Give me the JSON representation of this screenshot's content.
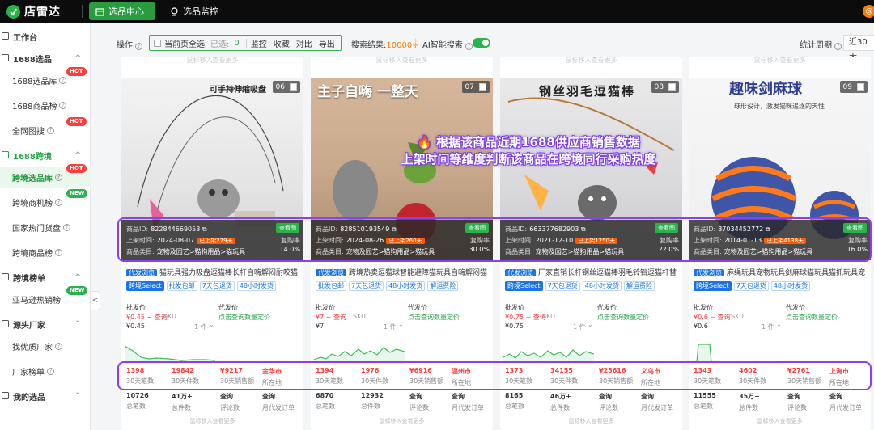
{
  "app": {
    "name": "店雷达",
    "tabs": [
      {
        "label": "选品中心",
        "active": true
      },
      {
        "label": "选品监控",
        "active": false
      }
    ],
    "user_initial": "赠"
  },
  "sidebar": {
    "items": [
      {
        "type": "group",
        "label": "工作台"
      },
      {
        "type": "group",
        "label": "1688选品",
        "arrow": "^"
      },
      {
        "type": "sub",
        "label": "1688选品库",
        "badge": "HOT",
        "q": true
      },
      {
        "type": "sub",
        "label": "1688商品榜",
        "q": true
      },
      {
        "type": "sub",
        "label": "全网图搜",
        "badge": "HOT",
        "q": true
      },
      {
        "type": "group",
        "label": "1688跨境",
        "arrow": "^",
        "green": true
      },
      {
        "type": "sub",
        "label": "跨境选品库",
        "badge": "HOT",
        "q": true,
        "active": true
      },
      {
        "type": "sub",
        "label": "跨境商机榜",
        "badge": "NEW",
        "q": true
      },
      {
        "type": "sub",
        "label": "国家热门货盘",
        "q": true
      },
      {
        "type": "sub",
        "label": "跨境商品榜",
        "q": true
      },
      {
        "type": "group",
        "label": "跨境榜单",
        "arrow": "^"
      },
      {
        "type": "sub",
        "label": "亚马逊热销榜",
        "badge": "NEW"
      },
      {
        "type": "group",
        "label": "源头厂家",
        "arrow": "^"
      },
      {
        "type": "sub",
        "label": "找优质厂家",
        "q": true
      },
      {
        "type": "sub",
        "label": "厂家榜单",
        "q": true
      },
      {
        "type": "group",
        "label": "我的选品",
        "arrow": "^"
      }
    ],
    "collapse": "<"
  },
  "toolbar": {
    "op_label": "操作",
    "select_page": "当前页全选",
    "selected_label": "已选:",
    "selected_count": "0",
    "actions": [
      "监控",
      "收藏",
      "对比",
      "导出"
    ],
    "search_result_label": "搜索结果:",
    "search_result_value": "10000+",
    "ai_search_label": "AI智能搜索",
    "period_label": "统计周期",
    "period_value": "近30天"
  },
  "faded_top": "鼠标移入查看更多",
  "annotation": {
    "line1": "根据该商品近期1688供应商销售数据",
    "line2": "上架时间等维度判断该商品在跨境同行采购热度"
  },
  "labels": {
    "product_id": "商品ID:",
    "listed": "上架时间:",
    "category": "商品类目:",
    "view": "查看图",
    "repurchase": "复购率",
    "batch_price": "批发价",
    "dropship_price": "代发价",
    "click_query": "点击查询数量定价",
    "sku": "SKU",
    "unit": "1 件",
    "s_30_orders": "30天笔数",
    "s_30_items": "30天件数",
    "s_30_sales": "30天销售额",
    "s_location": "所在地",
    "t_orders": "总笔数",
    "t_items": "总件数",
    "t_reviews": "评论数",
    "t_monthly": "月代发订单",
    "query": "查询",
    "hover_more": "鼠标移入查看更多"
  },
  "cards": [
    {
      "num": "06",
      "caption": "可手持伸缩吸盘",
      "sub": "",
      "id": "822844669053",
      "date": "2024-08-07",
      "on_days": "已上架279天",
      "category": "宠物及园艺>猫狗用品>猫玩具",
      "repurchase": "14.0%",
      "title_tag": "代发浏览",
      "title": "猫玩具强力吸盘逗猫棒长杆自嗨解闷耐咬猫...",
      "services": [
        "跨境Select",
        "批发包邮",
        "7天包退货",
        "48小时发货"
      ],
      "batch": "¥0.45 ~ 查询",
      "batch_sub": "¥0.45",
      "s1": "1398",
      "s2": "19842",
      "s3": "¥9217",
      "s4": "金华市",
      "t1": "10726",
      "t2": "41万+",
      "t3": "查询",
      "t4": "查询"
    },
    {
      "num": "07",
      "caption": "主子自嗨 一整天",
      "sub": "",
      "id": "828510193549",
      "date": "2024-08-26",
      "on_days": "已上架260天",
      "category": "宠物及园艺>猫狗用品>猫玩具",
      "repurchase": "30.0%",
      "title_tag": "代发浏览",
      "title": "跨境热卖逗猫球智能避障猫玩具自嗨解闷猫...",
      "services": [
        "批发包邮",
        "7天包退货",
        "48小时发货",
        "解运费险"
      ],
      "batch": "¥7 ~ 查询",
      "batch_sub": "¥7",
      "s1": "1394",
      "s2": "1976",
      "s3": "¥6916",
      "s4": "温州市",
      "t1": "6870",
      "t2": "12932",
      "t3": "查询",
      "t4": "查询"
    },
    {
      "num": "08",
      "caption": "钢丝羽毛逗猫棒",
      "sub": "",
      "id": "663377682903",
      "date": "2021-12-10",
      "on_days": "已上架1250天",
      "category": "宠物及园艺>猫狗用品>猫玩具",
      "repurchase": "22.0%",
      "title_tag": "代发浏览",
      "title": "厂家直销长杆钢丝逗猫棒羽毛铃铛逗猫杆替...",
      "services": [
        "跨境Select",
        "7天包退货",
        "48小时发货",
        "解运费险"
      ],
      "batch": "¥0.75 ~ 查询",
      "batch_sub": "¥0.75",
      "s1": "1373",
      "s2": "34155",
      "s3": "¥25616",
      "s4": "义乌市",
      "t1": "8165",
      "t2": "46万+",
      "t3": "查询",
      "t4": "查询"
    },
    {
      "num": "09",
      "caption": "趣味剑麻球",
      "sub": "球形设计，激发猫咪追逐的天性",
      "id": "37034452772",
      "date": "2014-01-13",
      "on_days": "已上架4138天",
      "category": "宠物及园艺>猫狗用品>猫玩具",
      "repurchase": "16.0%",
      "title_tag": "代发浏览",
      "title": "麻绳玩具宠物玩具剑麻球猫玩具猫抓玩具宠...",
      "services": [
        "跨境Select",
        "7天包退货",
        "48小时发货"
      ],
      "batch": "¥0.6 ~ 查询",
      "batch_sub": "¥0.6",
      "s1": "1343",
      "s2": "4602",
      "s3": "¥2761",
      "s4": "上海市",
      "t1": "11555",
      "t2": "35万+",
      "t3": "查询",
      "t4": "查询"
    }
  ],
  "colors": {
    "brand_green": "#2aa34a",
    "annotation_purple": "#8a3ff2",
    "price_red": "#ff3b3b"
  }
}
